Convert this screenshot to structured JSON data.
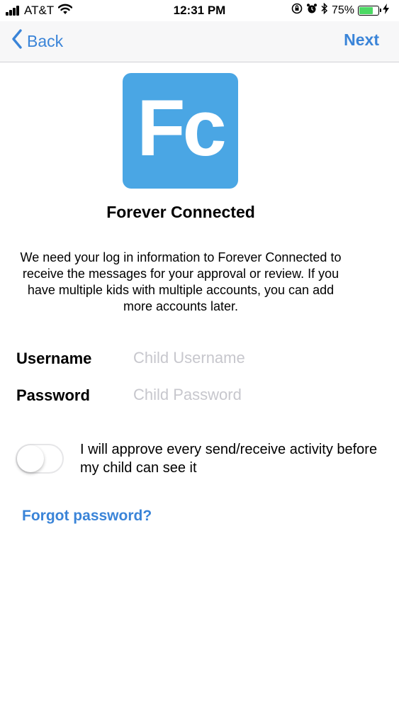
{
  "status_bar": {
    "carrier": "AT&T",
    "time": "12:31 PM",
    "battery_percent": "75%",
    "battery_level": 0.75,
    "icons": [
      "signal-icon",
      "wifi-icon",
      "orientation-lock-icon",
      "alarm-icon",
      "bluetooth-icon",
      "battery-icon",
      "charging-icon"
    ]
  },
  "nav": {
    "back_label": "Back",
    "next_label": "Next"
  },
  "app": {
    "logo_text": "Fc",
    "name": "Forever Connected",
    "brand_color": "#4aa6e4"
  },
  "description": "We need your log in information to Forever Connected to receive the messages for your approval or review. If you have multiple kids with multiple accounts, you can add more accounts later.",
  "form": {
    "username_label": "Username",
    "username_placeholder": "Child Username",
    "username_value": "",
    "password_label": "Password",
    "password_placeholder": "Child Password",
    "password_value": ""
  },
  "approval_toggle": {
    "label": "I will approve every send/receive activity before my child can see it",
    "on": false
  },
  "forgot_password_label": "Forgot password?",
  "accent_color": "#3a84d8"
}
